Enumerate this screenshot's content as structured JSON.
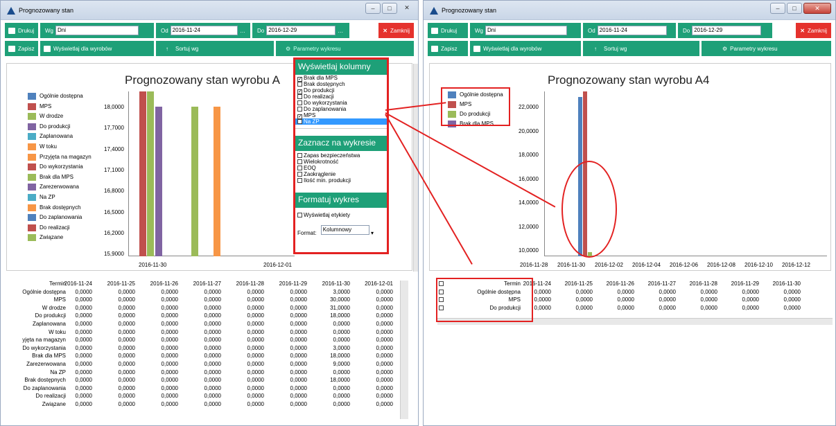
{
  "windowA": {
    "title": "Prognozowany stan",
    "toolbar": {
      "print": "Drukuj",
      "wg_label": "Wg",
      "wg_value": "Dni",
      "od_label": "Od",
      "od_value": "2016-11-24",
      "do_label": "Do",
      "do_value": "2016-12-29",
      "close": "Zamknij",
      "save": "Zapisz",
      "show_for": "Wyświetlaj dla wyrobów",
      "sort": "Sortuj wg",
      "chart_params": "Parametry wykresu"
    },
    "chart_title": "Prognozowany stan wyrobu A",
    "legend": [
      {
        "label": "Ogólnie dostępna",
        "color": "#4f81bd"
      },
      {
        "label": "MPS",
        "color": "#c0504d"
      },
      {
        "label": "W drodze",
        "color": "#9bbb59"
      },
      {
        "label": "Do produkcji",
        "color": "#8064a2"
      },
      {
        "label": "Zaplanowana",
        "color": "#4bacc6"
      },
      {
        "label": "W toku",
        "color": "#f79646"
      },
      {
        "label": "Przyjęta na magazyn",
        "color": "#f79646"
      },
      {
        "label": "Do wykorzystania",
        "color": "#c0504d"
      },
      {
        "label": "Brak dla MPS",
        "color": "#9bbb59"
      },
      {
        "label": "Zarezerwowana",
        "color": "#8064a2"
      },
      {
        "label": "Na ZP",
        "color": "#4bacc6"
      },
      {
        "label": "Brak dostępnych",
        "color": "#f79646"
      },
      {
        "label": "Do zaplanowania",
        "color": "#4f81bd"
      },
      {
        "label": "Do realizacji",
        "color": "#c0504d"
      },
      {
        "label": "Związane",
        "color": "#9bbb59"
      }
    ],
    "yticks": [
      "18,0000",
      "17,7000",
      "17,4000",
      "17,1000",
      "16,8000",
      "16,5000",
      "16,2000",
      "15,9000"
    ],
    "xticks": [
      "2016-11-30",
      "2016-12-01"
    ],
    "popup": {
      "h1": "Wyświetlaj kolumny",
      "cols": [
        {
          "t": "Brak dla MPS",
          "c": true
        },
        {
          "t": "Brak dostępnych",
          "c": false
        },
        {
          "t": "Do produkcji",
          "c": true
        },
        {
          "t": "Do realizacji",
          "c": false
        },
        {
          "t": "Do wykorzystania",
          "c": false
        },
        {
          "t": "Do zaplanowania",
          "c": false
        },
        {
          "t": "MPS",
          "c": true
        },
        {
          "t": "Na ZP",
          "c": false
        }
      ],
      "h2": "Zaznacz na wykresie",
      "marks": [
        "Zapas bezpieczeństwa",
        "Wielokrotność",
        "EOQ",
        "Zaokrąglenie",
        "Ilość min. produkcji"
      ],
      "h3": "Formatuj wykres",
      "labels_opt": "Wyświetlaj etykiety",
      "format_label": "Format:",
      "format_value": "Kolumnowy"
    },
    "table": {
      "head": "Termin",
      "dates": [
        "2016-11-24",
        "2016-11-25",
        "2016-11-26",
        "2016-11-27",
        "2016-11-28",
        "2016-11-29",
        "2016-11-30",
        "2016-12-01"
      ],
      "rows": [
        {
          "name": "Ogólnie dostępna",
          "vals": [
            "0,0000",
            "0,0000",
            "0,0000",
            "0,0000",
            "0,0000",
            "0,0000",
            "3,0000",
            "0,0000"
          ]
        },
        {
          "name": "MPS",
          "vals": [
            "0,0000",
            "0,0000",
            "0,0000",
            "0,0000",
            "0,0000",
            "0,0000",
            "30,0000",
            "0,0000"
          ]
        },
        {
          "name": "W drodze",
          "vals": [
            "0,0000",
            "0,0000",
            "0,0000",
            "0,0000",
            "0,0000",
            "0,0000",
            "31,0000",
            "0,0000"
          ]
        },
        {
          "name": "Do produkcji",
          "vals": [
            "0,0000",
            "0,0000",
            "0,0000",
            "0,0000",
            "0,0000",
            "0,0000",
            "18,0000",
            "0,0000"
          ]
        },
        {
          "name": "Zaplanowana",
          "vals": [
            "0,0000",
            "0,0000",
            "0,0000",
            "0,0000",
            "0,0000",
            "0,0000",
            "0,0000",
            "0,0000"
          ]
        },
        {
          "name": "W toku",
          "vals": [
            "0,0000",
            "0,0000",
            "0,0000",
            "0,0000",
            "0,0000",
            "0,0000",
            "0,0000",
            "0,0000"
          ]
        },
        {
          "name": "yjęta na magazyn",
          "vals": [
            "0,0000",
            "0,0000",
            "0,0000",
            "0,0000",
            "0,0000",
            "0,0000",
            "0,0000",
            "0,0000"
          ]
        },
        {
          "name": "Do wykorzystania",
          "vals": [
            "0,0000",
            "0,0000",
            "0,0000",
            "0,0000",
            "0,0000",
            "0,0000",
            "3,0000",
            "0,0000"
          ]
        },
        {
          "name": "Brak dla MPS",
          "vals": [
            "0,0000",
            "0,0000",
            "0,0000",
            "0,0000",
            "0,0000",
            "0,0000",
            "18,0000",
            "0,0000"
          ]
        },
        {
          "name": "Zarezerwowana",
          "vals": [
            "0,0000",
            "0,0000",
            "0,0000",
            "0,0000",
            "0,0000",
            "0,0000",
            "9,0000",
            "0,0000"
          ]
        },
        {
          "name": "Na ZP",
          "vals": [
            "0,0000",
            "0,0000",
            "0,0000",
            "0,0000",
            "0,0000",
            "0,0000",
            "0,0000",
            "0,0000"
          ]
        },
        {
          "name": "Brak dostępnych",
          "vals": [
            "0,0000",
            "0,0000",
            "0,0000",
            "0,0000",
            "0,0000",
            "0,0000",
            "18,0000",
            "0,0000"
          ]
        },
        {
          "name": "Do zaplanowania",
          "vals": [
            "0,0000",
            "0,0000",
            "0,0000",
            "0,0000",
            "0,0000",
            "0,0000",
            "0,0000",
            "0,0000"
          ]
        },
        {
          "name": "Do realizacji",
          "vals": [
            "0,0000",
            "0,0000",
            "0,0000",
            "0,0000",
            "0,0000",
            "0,0000",
            "0,0000",
            "0,0000"
          ]
        },
        {
          "name": "Związane",
          "vals": [
            "0,0000",
            "0,0000",
            "0,0000",
            "0,0000",
            "0,0000",
            "0,0000",
            "0,0000",
            "0,0000"
          ]
        }
      ]
    }
  },
  "windowB": {
    "title": "Prognozowany stan",
    "toolbar": {
      "print": "Drukuj",
      "wg_label": "Wg",
      "wg_value": "Dni",
      "od_label": "Od",
      "od_value": "2016-11-24",
      "do_label": "Do",
      "do_value": "2016-12-29",
      "close": "Zamknij",
      "save": "Zapisz",
      "show_for": "Wyświetlaj dla wyrobów",
      "sort": "Sortuj wg",
      "chart_params": "Parametry wykresu"
    },
    "chart_title": "Prognozowany stan wyrobu A4",
    "legend": [
      {
        "label": "Ogólnie dostępna",
        "color": "#4f81bd"
      },
      {
        "label": "MPS",
        "color": "#c0504d"
      },
      {
        "label": "Do produkcji",
        "color": "#9bbb59"
      },
      {
        "label": "Brak dla MPS",
        "color": "#8064a2"
      }
    ],
    "yticks": [
      "22,0000",
      "20,0000",
      "18,0000",
      "16,0000",
      "14,0000",
      "12,0000",
      "10,0000"
    ],
    "xticks": [
      "2016-11-28",
      "2016-11-30",
      "2016-12-02",
      "2016-12-04",
      "2016-12-06",
      "2016-12-08",
      "2016-12-10",
      "2016-12-12"
    ],
    "table": {
      "head": "Termin",
      "dates": [
        "2016-11-24",
        "2016-11-25",
        "2016-11-26",
        "2016-11-27",
        "2016-11-28",
        "2016-11-29",
        "2016-11-30"
      ],
      "rows": [
        {
          "name": "Ogólnie dostępna",
          "vals": [
            "0,0000",
            "0,0000",
            "0,0000",
            "0,0000",
            "0,0000",
            "0,0000",
            "0,0000"
          ]
        },
        {
          "name": "MPS",
          "vals": [
            "0,0000",
            "0,0000",
            "0,0000",
            "0,0000",
            "0,0000",
            "0,0000",
            "0,0000"
          ]
        },
        {
          "name": "Do produkcji",
          "vals": [
            "0,0000",
            "0,0000",
            "0,0000",
            "0,0000",
            "0,0000",
            "0,0000",
            "0,0000"
          ]
        }
      ]
    }
  },
  "accent": "#1ea078",
  "highlight": "#e32121"
}
